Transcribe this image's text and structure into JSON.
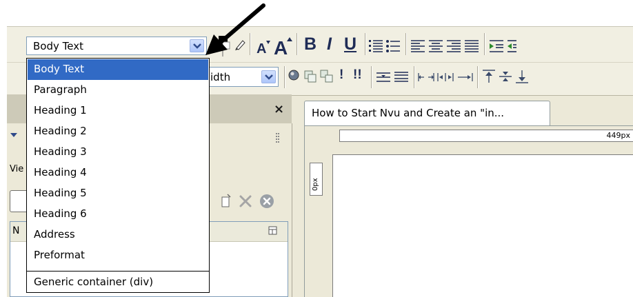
{
  "toolbar": {
    "format_select": {
      "value": "Body Text",
      "options": [
        "Body Text",
        "Paragraph",
        "Heading 1",
        "Heading 2",
        "Heading 3",
        "Heading 4",
        "Heading 5",
        "Heading 6",
        "Address",
        "Preformat"
      ],
      "extra_option": "Generic container (div)"
    },
    "width_select_value": "idth",
    "bold_label": "B",
    "italic_label": "I",
    "underline_label": "U",
    "exclaim_label": "!",
    "double_exclaim_label": "!!"
  },
  "sidebar": {
    "close_label": "×",
    "view_label": "Vie",
    "column_header": "N"
  },
  "editor": {
    "tab_title": "How to Start Nvu and Create an \"in...",
    "ruler_h_label": "449px",
    "ruler_v_label": "0px"
  },
  "colors": {
    "selection": "#316ac5",
    "toolbar_bg": "#f1efe2",
    "sidebar_header": "#cdcab8"
  }
}
